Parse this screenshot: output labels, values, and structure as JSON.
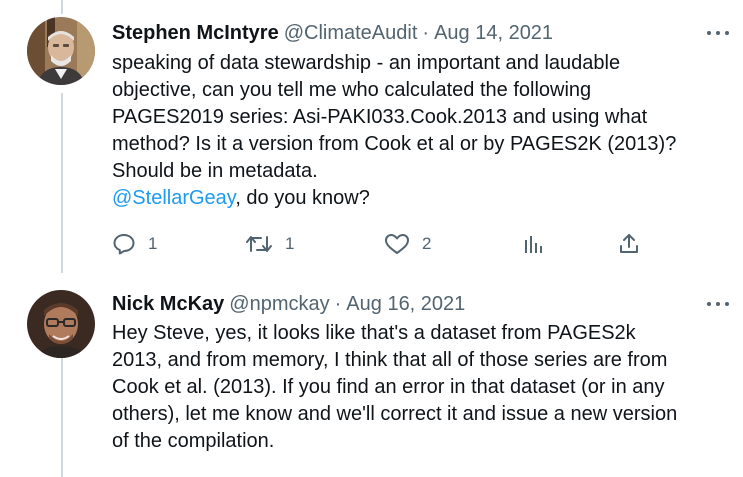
{
  "tweets": [
    {
      "name": "Stephen McIntyre",
      "handle": "@ClimateAudit",
      "separator": "·",
      "date": "Aug 14, 2021",
      "body_lines": [
        "speaking of data stewardship - an important and laudable",
        "objective, can you tell me who calculated the following",
        "PAGES2019 series: Asi-PAKI033.Cook.2013 and using what",
        "method? Is it a version from Cook et al or by PAGES2K (2013)?",
        "Should be in metadata."
      ],
      "mention": "@StellarGeay",
      "mention_rest": ", do you know?",
      "actions": {
        "reply_count": "1",
        "retweet_count": "1",
        "like_count": "2"
      },
      "icons": [
        "reply-icon",
        "retweet-icon",
        "like-icon",
        "views-icon",
        "share-icon"
      ]
    },
    {
      "name": "Nick McKay",
      "handle": "@npmckay",
      "separator": "·",
      "date": "Aug 16, 2021",
      "body_lines": [
        "Hey Steve, yes, it looks like that's a dataset from PAGES2k",
        "2013, and from memory, I think that all of those series are from",
        "Cook et al. (2013). If you find an error in that dataset (or in any",
        "others), let me know and we'll correct it and issue a new version",
        "of the compilation."
      ]
    }
  ],
  "colors": {
    "text": "#0f1419",
    "secondary": "#536471",
    "link": "#1d9bf0",
    "thread_line": "#cfd9de"
  }
}
